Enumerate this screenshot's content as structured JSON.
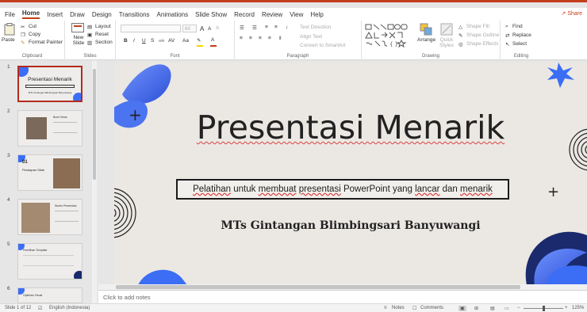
{
  "menu": {
    "tabs": [
      "File",
      "Home",
      "Insert",
      "Draw",
      "Design",
      "Transitions",
      "Animations",
      "Slide Show",
      "Record",
      "Review",
      "View",
      "Help"
    ],
    "active": "Home",
    "share_label": "Share"
  },
  "ribbon": {
    "clipboard": {
      "label": "Clipboard",
      "paste": "Paste",
      "cut": "Cut",
      "copy": "Copy",
      "format_painter": "Format Painter"
    },
    "slides": {
      "label": "Slides",
      "new_slide": "New Slide",
      "layout": "Layout",
      "reset": "Reset",
      "section": "Section"
    },
    "font": {
      "label": "Font",
      "font_size": "60",
      "bold": "B",
      "italic": "I",
      "underline": "U",
      "strike": "S",
      "shadow": "ab",
      "spacing": "AV",
      "case": "Aa",
      "grow": "A",
      "shrink": "A",
      "clear": "A"
    },
    "paragraph": {
      "label": "Paragraph",
      "text_direction": "Text Direction",
      "align_text": "Align Text",
      "smartart": "Convert to SmartArt"
    },
    "drawing": {
      "label": "Drawing",
      "arrange": "Arrange",
      "quick_styles": "Quick Styles",
      "shape_fill": "Shape Fill",
      "shape_outline": "Shape Outline",
      "shape_effects": "Shape Effects"
    },
    "editing": {
      "label": "Editing",
      "find": "Find",
      "replace": "Replace",
      "select": "Select"
    }
  },
  "thumbnails": [
    {
      "num": "1",
      "title": "Presentasi Menarik",
      "sub": "MTs Gintangan Blimbingsari Banyuwangi"
    },
    {
      "num": "2",
      "title": "Bumi Kelas"
    },
    {
      "num": "3",
      "title": "01",
      "sub": "Persiapan Slide"
    },
    {
      "num": "4",
      "title": "Studio Presentasi"
    },
    {
      "num": "5",
      "title": "Pemilihan Template"
    },
    {
      "num": "6",
      "title": "Optimasi Visual"
    }
  ],
  "slide": {
    "title": "Presentasi Menarik",
    "box_segments": [
      "Pelatihan",
      " untuk ",
      "membuat",
      " ",
      "presentasi",
      " PowerPoint yang ",
      "lancar",
      " dan ",
      "menarik"
    ],
    "subtitle": "MTs Gintangan Blimbingsari Banyuwangi",
    "plus1": "+",
    "plus2": "+",
    "accent_blue": "#3b6ef5",
    "accent_navy": "#1a2a6c"
  },
  "notes": {
    "placeholder": "Click to add notes"
  },
  "status": {
    "slide_of": "Slide 1 of 12",
    "language": "English (Indonesia)",
    "notes": "Notes",
    "comments": "Comments",
    "zoom": "125%"
  }
}
